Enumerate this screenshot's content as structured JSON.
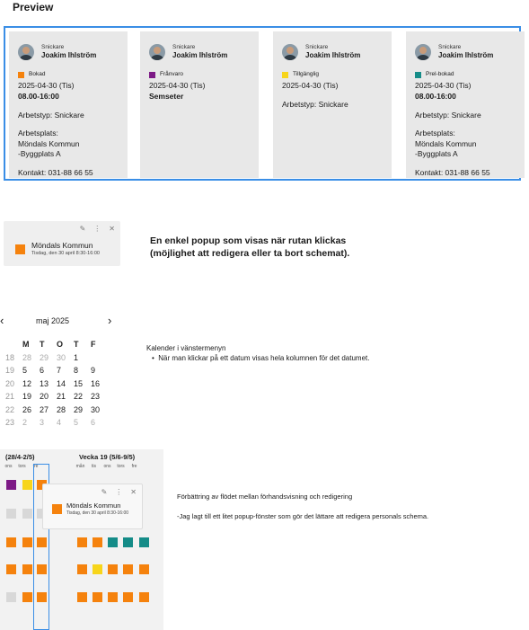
{
  "preview_title": "Preview",
  "colors": {
    "booked": "#f5820d",
    "absent": "#7d1a86",
    "available": "#f7d51b",
    "prebooked": "#158c88",
    "frame": "#3a8ee6"
  },
  "cards": [
    {
      "role": "Snickare",
      "name": "Joakim Ihlström",
      "status": "Bokad",
      "status_color": "#f5820d",
      "date": "2025-04-30 (Tis)",
      "time": "08.00-16:00",
      "work_type": "Arbetstyp: Snickare",
      "workplace_label": "Arbetsplats:",
      "workplace_1": "Möndals Kommun",
      "workplace_2": "-Byggplats A",
      "contact": "Kontakt: 031-88 66 55"
    },
    {
      "role": "Snickare",
      "name": "Joakim Ihlström",
      "status": "Frånvaro",
      "status_color": "#7d1a86",
      "date": "2025-04-30 (Tis)",
      "time": "Semseter",
      "work_type": "",
      "workplace_label": "",
      "workplace_1": "",
      "workplace_2": "",
      "contact": ""
    },
    {
      "role": "Snickare",
      "name": "Joakim Ihlström",
      "status": "Tillgänglig",
      "status_color": "#f7d51b",
      "date": "2025-04-30 (Tis)",
      "time": "",
      "work_type": "Arbetstyp: Snickare",
      "workplace_label": "",
      "workplace_1": "",
      "workplace_2": "",
      "contact": ""
    },
    {
      "role": "Snickare",
      "name": "Joakim Ihlström",
      "status": "Prel-bokad",
      "status_color": "#158c88",
      "date": "2025-04-30 (Tis)",
      "time": "08.00-16:00",
      "work_type": "Arbetstyp: Snickare",
      "workplace_label": "Arbetsplats:",
      "workplace_1": "Möndals Kommun",
      "workplace_2": "-Byggplats A",
      "contact": "Kontakt: 031-88 66 55"
    }
  ],
  "popup": {
    "title": "Möndals Kommun",
    "subtitle": "Tisdag, den 30 april 8:30-16:00",
    "icons": [
      "edit-icon",
      "more-icon",
      "close-icon"
    ]
  },
  "popup_description_1": "En enkel popup som visas när rutan klickas",
  "popup_description_2": "(möjlighet att redigera eller ta bort schemat).",
  "calendar": {
    "month": "maj 2025",
    "prev": "‹",
    "next": "›",
    "weekdays": [
      "M",
      "T",
      "O",
      "T",
      "F"
    ],
    "rows": [
      {
        "week": "18",
        "days": [
          "28",
          "29",
          "30",
          "1"
        ],
        "dim": [
          true,
          true,
          true,
          false
        ]
      },
      {
        "week": "19",
        "days": [
          "5",
          "6",
          "7",
          "8",
          "9"
        ],
        "dim": [
          false,
          false,
          false,
          false,
          false
        ]
      },
      {
        "week": "20",
        "days": [
          "12",
          "13",
          "14",
          "15",
          "16"
        ],
        "dim": [
          false,
          false,
          false,
          false,
          false
        ]
      },
      {
        "week": "21",
        "days": [
          "19",
          "20",
          "21",
          "22",
          "23"
        ],
        "dim": [
          false,
          false,
          false,
          false,
          false
        ]
      },
      {
        "week": "22",
        "days": [
          "26",
          "27",
          "28",
          "29",
          "30"
        ],
        "dim": [
          false,
          false,
          false,
          false,
          false
        ]
      },
      {
        "week": "23",
        "days": [
          "2",
          "3",
          "4",
          "5",
          "6"
        ],
        "dim": [
          true,
          true,
          true,
          true,
          true
        ]
      }
    ]
  },
  "calendar_desc_title": "Kalender i vänstermenyn",
  "calendar_desc_bullet": "När man klickar på ett datum visas hela kolumnen för det datumet.",
  "schedule": {
    "week_a": "(28/4-2/5)",
    "week_b": "Vecka 19 (5/6-9/5)",
    "days_a": [
      "ons",
      "tors",
      "fre"
    ],
    "days_b": [
      "mån",
      "tis",
      "ons",
      "tors",
      "fre"
    ]
  },
  "improve_title": "Förbättring av flödet mellan förhandsvisning och redigering",
  "improve_text": "-Jag lagt till ett litet popup-fönster som gör det lättare att redigera personals schema."
}
